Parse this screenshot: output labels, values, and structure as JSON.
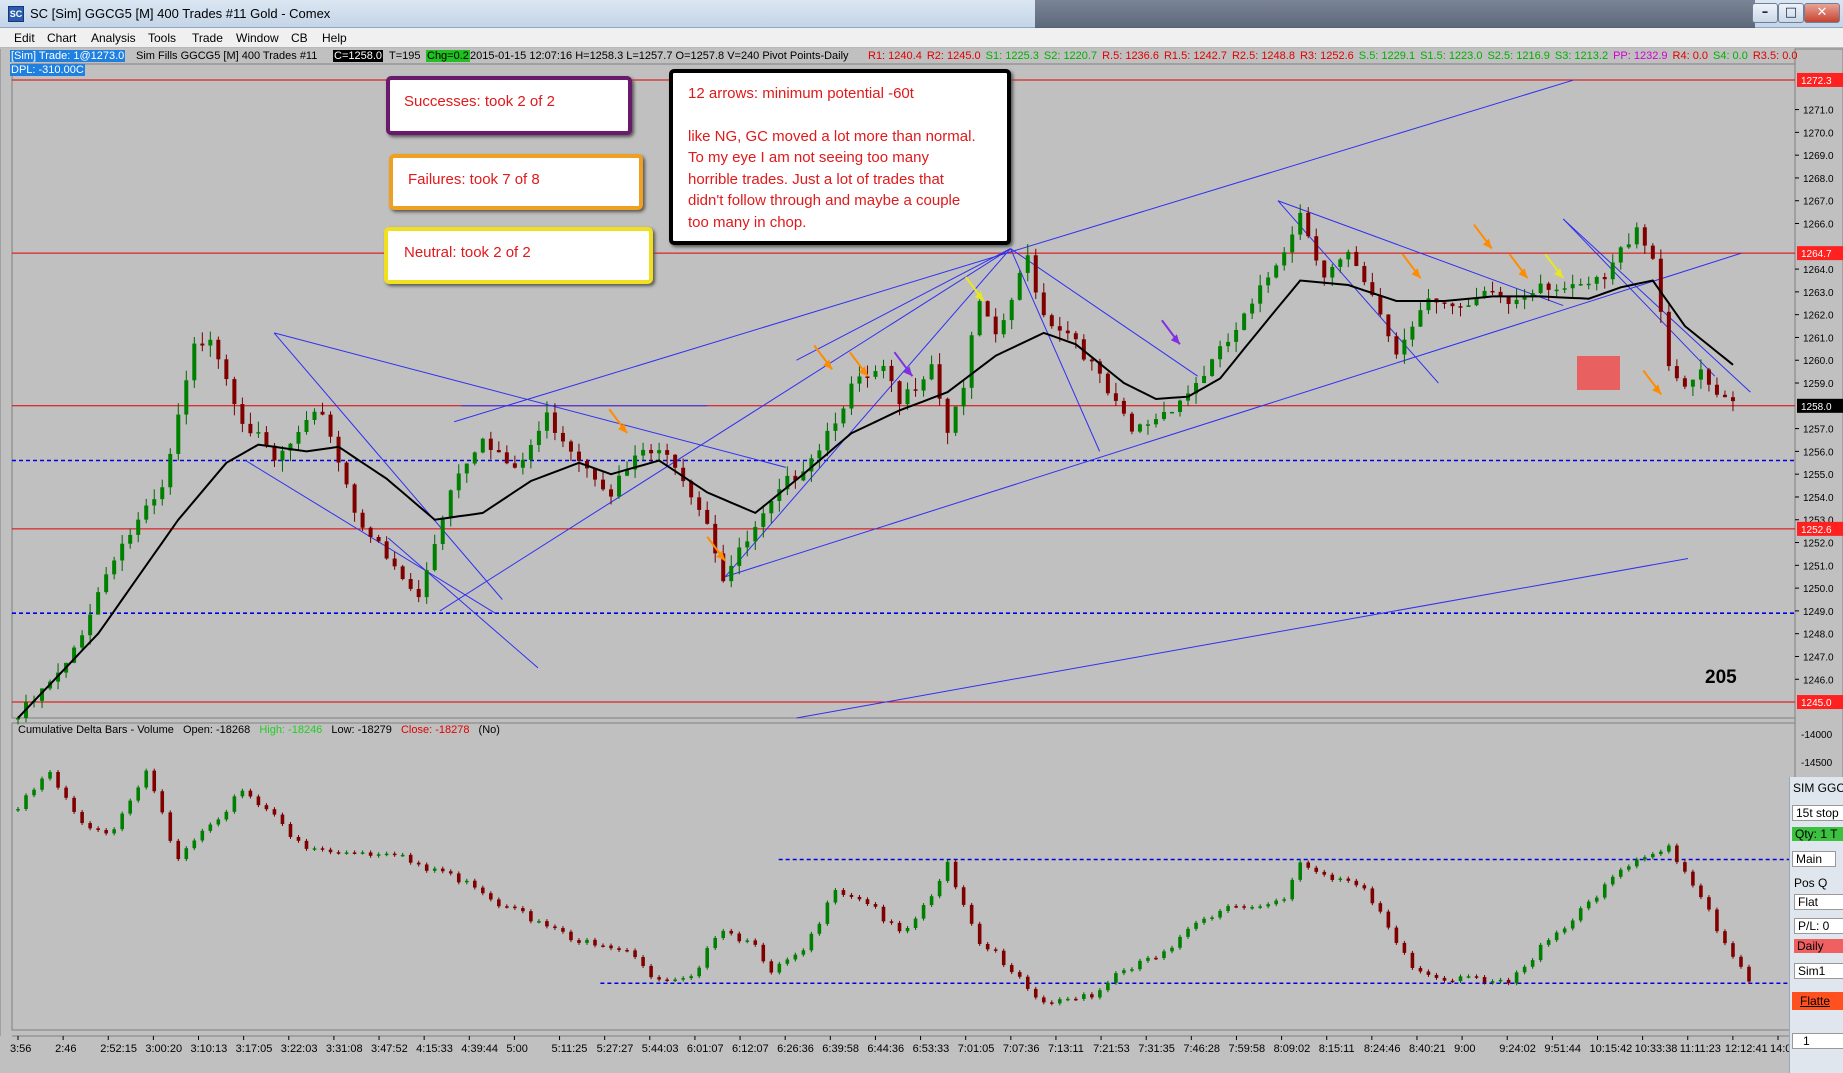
{
  "window": {
    "title": "SC [Sim] GGCG5 [M]  400 Trades  #11  Gold - Comex",
    "menus": [
      "Edit",
      "Chart",
      "Analysis",
      "Tools",
      "Trade",
      "Window",
      "CB",
      "Help"
    ]
  },
  "infobar": {
    "account": "[Sim]  Trade: 1@1273.0",
    "sim_fills": "Sim Fills  GGCG5 [M]  400 Trades  #11",
    "close": "C=1258.0",
    "ticks": "T=195",
    "change": "Chg=0.2",
    "ohlc": "2015-01-15 12:07:16 H=1258.3 L=1257.7 O=1257.8 V=240 Pivot Points-Daily",
    "pivots": [
      {
        "text": "R1: 1240.4",
        "color": "#e00000"
      },
      {
        "text": "R2: 1245.0",
        "color": "#e00000"
      },
      {
        "text": "S1: 1225.3",
        "color": "#00b000"
      },
      {
        "text": "S2: 1220.7",
        "color": "#00b000"
      },
      {
        "text": "R.5: 1236.6",
        "color": "#e00000"
      },
      {
        "text": "R1.5: 1242.7",
        "color": "#e00000"
      },
      {
        "text": "R2.5: 1248.8",
        "color": "#e00000"
      },
      {
        "text": "R3: 1252.6",
        "color": "#e00000"
      },
      {
        "text": "S.5: 1229.1",
        "color": "#00b000"
      },
      {
        "text": "S1.5: 1223.0",
        "color": "#00b000"
      },
      {
        "text": "S2.5: 1216.9",
        "color": "#00b000"
      },
      {
        "text": "S3: 1213.2",
        "color": "#00b000"
      },
      {
        "text": "PP: 1232.9",
        "color": "#d000d0"
      },
      {
        "text": "R4: 0.0",
        "color": "#e00000"
      },
      {
        "text": "S4: 0.0",
        "color": "#00b000"
      },
      {
        "text": "R3.5: 0.0",
        "color": "#e00000"
      }
    ],
    "dpl": "DPL: -310.00C"
  },
  "notes": {
    "successes": "Successes: took 2 of 2",
    "failures": "Failures: took 7 of 8",
    "neutral": "Neutral: took 2 of 2",
    "main_lines": [
      "12 arrows: minimum potential -60t",
      "",
      "like NG, GC moved a lot more than normal.",
      "To my eye I am not seeing too many",
      "horrible trades.  Just a lot of trades that",
      "didn't follow through and maybe a couple",
      "too many in chop."
    ]
  },
  "bar_count_label": "205",
  "chart_data": [
    {
      "type": "candlestick",
      "panel": "price",
      "ylim": [
        1244.3,
        1273.0
      ],
      "yticks": [
        1246.0,
        1247.0,
        1248.0,
        1249.0,
        1250.0,
        1251.0,
        1252.0,
        1253.0,
        1254.0,
        1255.0,
        1256.0,
        1257.0,
        1259.0,
        1260.0,
        1261.0,
        1262.0,
        1263.0,
        1264.0,
        1266.0,
        1267.0,
        1268.0,
        1269.0,
        1270.0,
        1271.0
      ],
      "price_tags": [
        {
          "label": "1272.3",
          "value": 1272.3,
          "color": "#ff3030"
        },
        {
          "label": "1264.7",
          "value": 1264.7,
          "color": "#ff3030"
        },
        {
          "label": "1258.0",
          "value": 1258.0,
          "color": "#ffffff"
        },
        {
          "label": "1252.6",
          "value": 1252.6,
          "color": "#ff3030"
        },
        {
          "label": "1245.0",
          "value": 1245.0,
          "color": "#ff3030"
        }
      ],
      "horizontal_lines": [
        {
          "value": 1272.3,
          "style": "solid",
          "color": "#e00000"
        },
        {
          "value": 1264.7,
          "style": "solid",
          "color": "#e00000"
        },
        {
          "value": 1258.0,
          "style": "solid",
          "color": "#e00000"
        },
        {
          "value": 1252.6,
          "style": "solid",
          "color": "#e00000"
        },
        {
          "value": 1245.0,
          "style": "solid",
          "color": "#e00000"
        },
        {
          "value": 1255.6,
          "style": "dashed",
          "color": "#0000e0"
        },
        {
          "value": 1248.9,
          "style": "dashed",
          "color": "#0000e0"
        }
      ],
      "close_path": [
        [
          0,
          1244.3
        ],
        [
          6,
          1246.5
        ],
        [
          12,
          1251.5
        ],
        [
          18,
          1254.2
        ],
        [
          22,
          1260.5
        ],
        [
          24,
          1261.2
        ],
        [
          28,
          1257.5
        ],
        [
          32,
          1255.5
        ],
        [
          38,
          1257.8
        ],
        [
          42,
          1253.5
        ],
        [
          46,
          1251.2
        ],
        [
          50,
          1249.5
        ],
        [
          54,
          1254.5
        ],
        [
          58,
          1256.8
        ],
        [
          62,
          1255.0
        ],
        [
          66,
          1257.5
        ],
        [
          70,
          1255.8
        ],
        [
          74,
          1254.3
        ],
        [
          78,
          1256.0
        ],
        [
          82,
          1255.6
        ],
        [
          86,
          1253.0
        ],
        [
          88,
          1250.5
        ],
        [
          92,
          1252.5
        ],
        [
          96,
          1254.6
        ],
        [
          100,
          1256.3
        ],
        [
          104,
          1258.8
        ],
        [
          108,
          1259.5
        ],
        [
          110,
          1258.0
        ],
        [
          114,
          1260.0
        ],
        [
          116,
          1257.0
        ],
        [
          118,
          1259.0
        ],
        [
          120,
          1262.5
        ],
        [
          122,
          1260.8
        ],
        [
          126,
          1264.5
        ],
        [
          128,
          1262.0
        ],
        [
          132,
          1261.0
        ],
        [
          136,
          1258.5
        ],
        [
          139,
          1256.8
        ],
        [
          142,
          1257.5
        ],
        [
          146,
          1258.6
        ],
        [
          150,
          1260.3
        ],
        [
          154,
          1262.3
        ],
        [
          158,
          1265.0
        ],
        [
          160,
          1266.5
        ],
        [
          163,
          1263.8
        ],
        [
          166,
          1264.5
        ],
        [
          170,
          1262.0
        ],
        [
          172,
          1260.3
        ],
        [
          176,
          1263.0
        ],
        [
          180,
          1262.0
        ],
        [
          184,
          1263.0
        ],
        [
          186,
          1262.5
        ],
        [
          190,
          1263.5
        ],
        [
          194,
          1263.0
        ],
        [
          198,
          1263.5
        ],
        [
          202,
          1266.0
        ],
        [
          204,
          1264.5
        ],
        [
          206,
          1260.0
        ],
        [
          208,
          1258.5
        ],
        [
          210,
          1259.5
        ],
        [
          212,
          1258.2
        ],
        [
          214,
          1258.0
        ]
      ],
      "trend_lines": [
        [
          [
            0.147,
            1261.2
          ],
          [
            0.275,
            1249.5
          ]
        ],
        [
          [
            0.147,
            1261.2
          ],
          [
            0.434,
            1255.3
          ]
        ],
        [
          [
            0.131,
            1255.6
          ],
          [
            0.271,
            1248.9
          ]
        ],
        [
          [
            0.211,
            1252.2
          ],
          [
            0.295,
            1246.5
          ]
        ],
        [
          [
            0.24,
            1249.0
          ],
          [
            0.56,
            1264.9
          ]
        ],
        [
          [
            0.248,
            1257.3
          ],
          [
            0.876,
            1272.3
          ]
        ],
        [
          [
            0.252,
            1258.0
          ],
          [
            0.39,
            1258.0
          ]
        ],
        [
          [
            0.4,
            1250.5
          ],
          [
            0.56,
            1264.9
          ]
        ],
        [
          [
            0.4,
            1250.5
          ],
          [
            0.97,
            1264.7
          ]
        ],
        [
          [
            0.56,
            1264.9
          ],
          [
            0.61,
            1256.0
          ]
        ],
        [
          [
            0.44,
            1260.0
          ],
          [
            0.56,
            1264.9
          ]
        ],
        [
          [
            0.56,
            1264.9
          ],
          [
            0.665,
            1259.3
          ]
        ],
        [
          [
            0.71,
            1267.0
          ],
          [
            0.8,
            1259.0
          ]
        ],
        [
          [
            0.71,
            1267.0
          ],
          [
            0.87,
            1262.4
          ]
        ],
        [
          [
            0.87,
            1266.2
          ],
          [
            0.975,
            1258.6
          ]
        ],
        [
          [
            0.87,
            1266.2
          ],
          [
            0.955,
            1259.3
          ]
        ],
        [
          [
            0.44,
            1244.3
          ],
          [
            0.94,
            1251.3
          ]
        ]
      ],
      "arrows": [
        {
          "color": "#ff8c00",
          "at": [
            0.345,
            1256.8
          ]
        },
        {
          "color": "#ff8c00",
          "at": [
            0.4,
            1251.2
          ]
        },
        {
          "color": "#ff8c00",
          "at": [
            0.46,
            1259.6
          ]
        },
        {
          "color": "#ff8c00",
          "at": [
            0.48,
            1259.3
          ]
        },
        {
          "color": "#8030e0",
          "at": [
            0.505,
            1259.3
          ]
        },
        {
          "color": "#e8e820",
          "at": [
            0.545,
            1262.6
          ]
        },
        {
          "color": "#8030e0",
          "at": [
            0.655,
            1260.7
          ]
        },
        {
          "color": "#ff8c00",
          "at": [
            0.79,
            1263.6
          ]
        },
        {
          "color": "#ff8c00",
          "at": [
            0.83,
            1264.9
          ]
        },
        {
          "color": "#ff8c00",
          "at": [
            0.85,
            1263.6
          ]
        },
        {
          "color": "#e8e820",
          "at": [
            0.87,
            1263.6
          ]
        },
        {
          "color": "#ff8c00",
          "at": [
            0.925,
            1258.5
          ]
        }
      ],
      "moving_average": [
        [
          0,
          1244.3
        ],
        [
          10,
          1248.0
        ],
        [
          20,
          1253.0
        ],
        [
          26,
          1255.5
        ],
        [
          30,
          1256.3
        ],
        [
          36,
          1256.0
        ],
        [
          40,
          1256.2
        ],
        [
          46,
          1254.8
        ],
        [
          52,
          1253.0
        ],
        [
          58,
          1253.3
        ],
        [
          64,
          1254.7
        ],
        [
          70,
          1255.5
        ],
        [
          74,
          1255.0
        ],
        [
          80,
          1255.6
        ],
        [
          86,
          1254.2
        ],
        [
          92,
          1253.3
        ],
        [
          98,
          1255.0
        ],
        [
          104,
          1256.8
        ],
        [
          110,
          1257.8
        ],
        [
          116,
          1258.6
        ],
        [
          122,
          1260.2
        ],
        [
          128,
          1261.2
        ],
        [
          132,
          1260.7
        ],
        [
          138,
          1259.0
        ],
        [
          142,
          1258.3
        ],
        [
          146,
          1258.4
        ],
        [
          150,
          1259.2
        ],
        [
          156,
          1261.8
        ],
        [
          160,
          1263.5
        ],
        [
          166,
          1263.3
        ],
        [
          172,
          1262.6
        ],
        [
          178,
          1262.6
        ],
        [
          184,
          1262.8
        ],
        [
          190,
          1262.8
        ],
        [
          196,
          1262.7
        ],
        [
          200,
          1263.2
        ],
        [
          204,
          1263.5
        ],
        [
          208,
          1261.5
        ],
        [
          214,
          1259.8
        ]
      ]
    },
    {
      "type": "candlestick",
      "panel": "cumulative-delta",
      "title": "Cumulative Delta Bars - Volume",
      "stats": {
        "open": "Open: -18268",
        "high": "High: -18246",
        "low": "Low: -18279",
        "close": "Close: -18278",
        "flag": "(No)"
      },
      "ylim": [
        -18280,
        -14000
      ],
      "yticks": [
        -14000,
        -14500
      ],
      "horizontal_lines": [
        {
          "at": 0.42,
          "style": "dashed",
          "color": "#0000e0"
        },
        {
          "at": 0.97,
          "style": "dashed",
          "color": "#0000e0"
        }
      ],
      "close_path": [
        [
          0,
          0.2
        ],
        [
          4,
          0.02
        ],
        [
          8,
          0.25
        ],
        [
          12,
          0.3
        ],
        [
          16,
          0.05
        ],
        [
          20,
          0.4
        ],
        [
          24,
          0.25
        ],
        [
          28,
          0.12
        ],
        [
          30,
          0.18
        ],
        [
          36,
          0.36
        ],
        [
          42,
          0.4
        ],
        [
          48,
          0.42
        ],
        [
          54,
          0.48
        ],
        [
          60,
          0.64
        ],
        [
          66,
          0.7
        ],
        [
          72,
          0.82
        ],
        [
          76,
          0.84
        ],
        [
          80,
          0.95
        ],
        [
          84,
          0.92
        ],
        [
          88,
          0.75
        ],
        [
          92,
          0.82
        ],
        [
          94,
          0.9
        ],
        [
          98,
          0.8
        ],
        [
          102,
          0.58
        ],
        [
          106,
          0.62
        ],
        [
          110,
          0.72
        ],
        [
          112,
          0.68
        ],
        [
          116,
          0.45
        ],
        [
          118,
          0.64
        ],
        [
          120,
          0.8
        ],
        [
          124,
          0.9
        ],
        [
          128,
          1.05
        ],
        [
          134,
          1.04
        ],
        [
          138,
          0.9
        ],
        [
          142,
          0.84
        ],
        [
          146,
          0.74
        ],
        [
          150,
          0.66
        ],
        [
          154,
          0.62
        ],
        [
          158,
          0.58
        ],
        [
          160,
          0.44
        ],
        [
          164,
          0.52
        ],
        [
          168,
          0.54
        ],
        [
          170,
          0.64
        ],
        [
          174,
          0.9
        ],
        [
          178,
          0.98
        ],
        [
          182,
          0.94
        ],
        [
          186,
          0.95
        ],
        [
          190,
          0.82
        ],
        [
          194,
          0.7
        ],
        [
          198,
          0.52
        ],
        [
          202,
          0.4
        ],
        [
          206,
          0.38
        ],
        [
          210,
          0.6
        ],
        [
          214,
          0.84
        ],
        [
          216,
          0.95
        ]
      ]
    }
  ],
  "time_axis": [
    "3:56",
    "2:46",
    "2:52:15",
    "3:00:20",
    "3:10:13",
    "3:17:05",
    "3:22:03",
    "3:31:08",
    "3:47:52",
    "4:15:33",
    "4:39:44",
    "5:00",
    "5:11:25",
    "5:27:27",
    "5:44:03",
    "6:01:07",
    "6:12:07",
    "6:26:36",
    "6:39:58",
    "6:44:36",
    "6:53:33",
    "7:01:05",
    "7:07:36",
    "7:13:11",
    "7:21:53",
    "7:31:35",
    "7:46:28",
    "7:59:58",
    "8:09:02",
    "8:15:11",
    "8:24:46",
    "8:40:21",
    "9:00",
    "9:24:02",
    "9:51:44",
    "10:15:42",
    "10:33:38",
    "11:11:23",
    "12:12:41",
    "14:0"
  ],
  "side_panel": {
    "title": "SIM GGC",
    "stop": "15t stop",
    "qty": "Qty: 1 T",
    "tab": "Main",
    "pos": "Pos Q",
    "flat": "Flat",
    "pl": "P/L: 0",
    "daily": "Daily",
    "account": "Sim1",
    "flatten": "Flatte",
    "value": "1"
  }
}
